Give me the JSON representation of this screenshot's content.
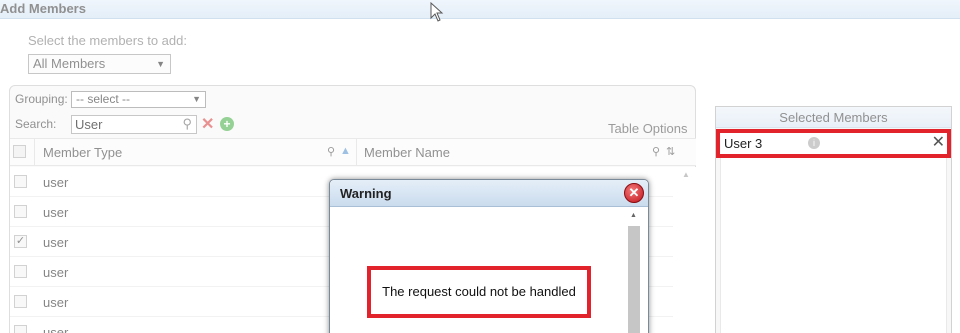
{
  "window": {
    "title": "Add Members"
  },
  "add": {
    "prompt": "Select the members to add:",
    "selected_option": "All Members"
  },
  "grid": {
    "grouping_label": "Grouping:",
    "grouping_value": "-- select --",
    "search_label": "Search:",
    "search_value": "User",
    "table_options": "Table Options",
    "columns": [
      "Member Type",
      "Member Name"
    ],
    "rows": [
      {
        "type": "user",
        "checked": false
      },
      {
        "type": "user",
        "checked": false
      },
      {
        "type": "user",
        "checked": true
      },
      {
        "type": "user",
        "checked": false
      },
      {
        "type": "user",
        "checked": false
      },
      {
        "type": "user",
        "checked": false
      }
    ]
  },
  "selected": {
    "header": "Selected Members",
    "items": [
      {
        "name": "User 3"
      }
    ]
  },
  "dialog": {
    "title": "Warning",
    "message": "The request could not be handled"
  },
  "icons": {
    "close": "close-icon",
    "info": "info-icon",
    "search": "search-icon",
    "add": "add-icon",
    "clear": "clear-icon"
  },
  "colors": {
    "highlight": "#e3232c",
    "accent": "#5cb85c"
  }
}
